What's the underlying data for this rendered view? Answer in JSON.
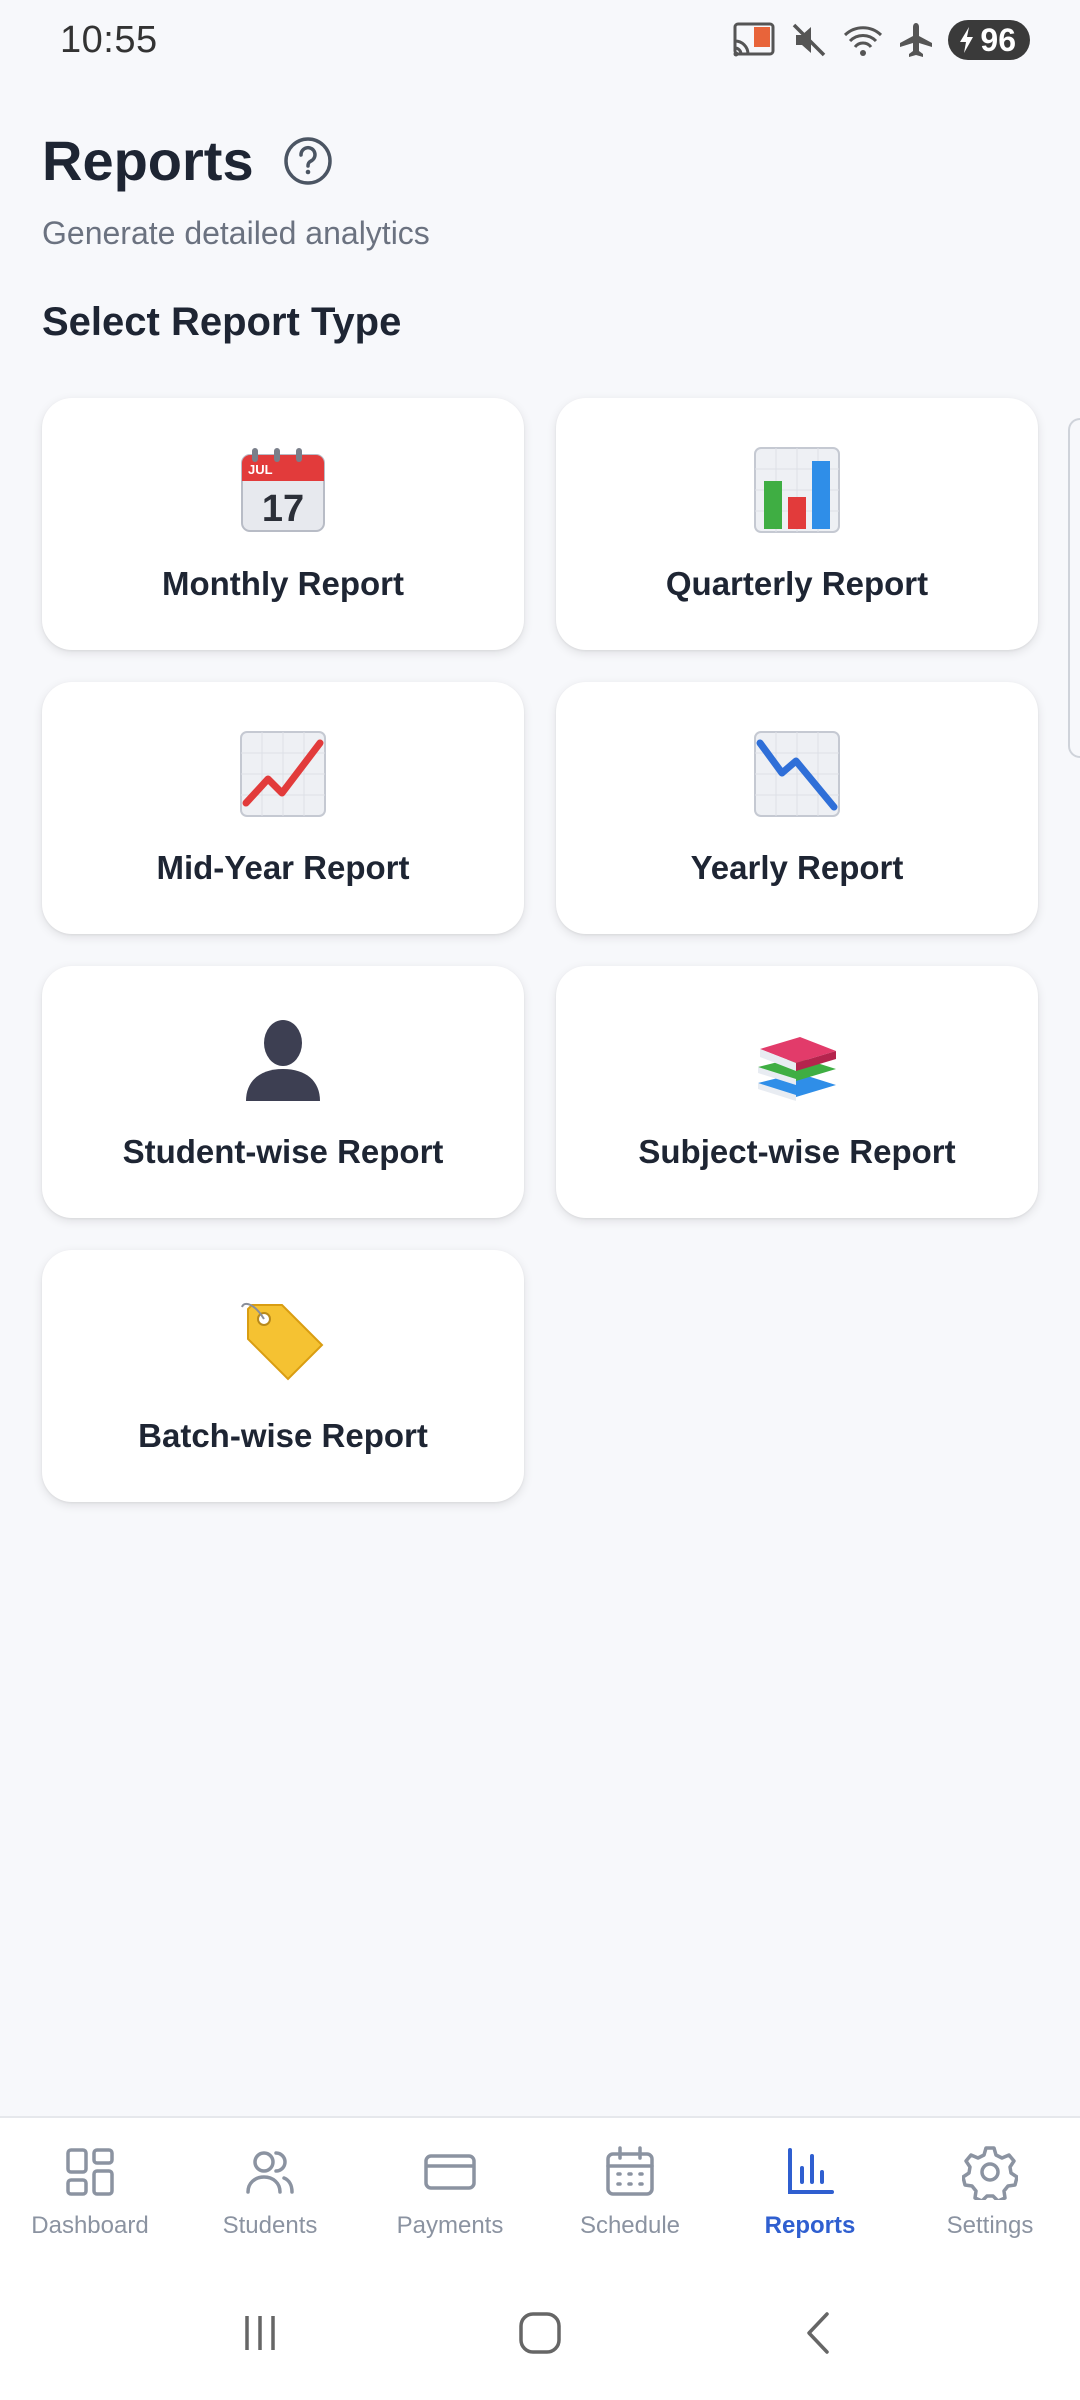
{
  "status_bar": {
    "time": "10:55",
    "battery": "96",
    "icons": [
      "cast-icon",
      "mute-icon",
      "wifi-icon",
      "airplane-icon",
      "battery-charging-icon"
    ]
  },
  "header": {
    "title": "Reports",
    "subtitle": "Generate detailed analytics",
    "help_icon": "help-circle-icon"
  },
  "section_title": "Select Report Type",
  "reports": [
    {
      "label": "Monthly Report",
      "icon": "calendar-icon"
    },
    {
      "label": "Quarterly Report",
      "icon": "bar-chart-icon"
    },
    {
      "label": "Mid-Year Report",
      "icon": "chart-increasing-icon"
    },
    {
      "label": "Yearly Report",
      "icon": "chart-decreasing-icon"
    },
    {
      "label": "Student-wise Report",
      "icon": "person-silhouette-icon"
    },
    {
      "label": "Subject-wise Report",
      "icon": "books-icon"
    },
    {
      "label": "Batch-wise Report",
      "icon": "tag-icon"
    }
  ],
  "calendar_icon": {
    "month": "JUL",
    "day": "17"
  },
  "bottom_nav": [
    {
      "label": "Dashboard",
      "icon": "dashboard-icon",
      "active": false
    },
    {
      "label": "Students",
      "icon": "users-icon",
      "active": false
    },
    {
      "label": "Payments",
      "icon": "card-icon",
      "active": false
    },
    {
      "label": "Schedule",
      "icon": "calendar-grid-icon",
      "active": false
    },
    {
      "label": "Reports",
      "icon": "bar-chart-icon",
      "active": true
    },
    {
      "label": "Settings",
      "icon": "gear-icon",
      "active": false
    }
  ],
  "colors": {
    "accent": "#2f5fd0",
    "inactive_nav": "#8b93a1",
    "title": "#1e2533",
    "subtitle": "#6b7280",
    "background": "#f7f8fb"
  }
}
